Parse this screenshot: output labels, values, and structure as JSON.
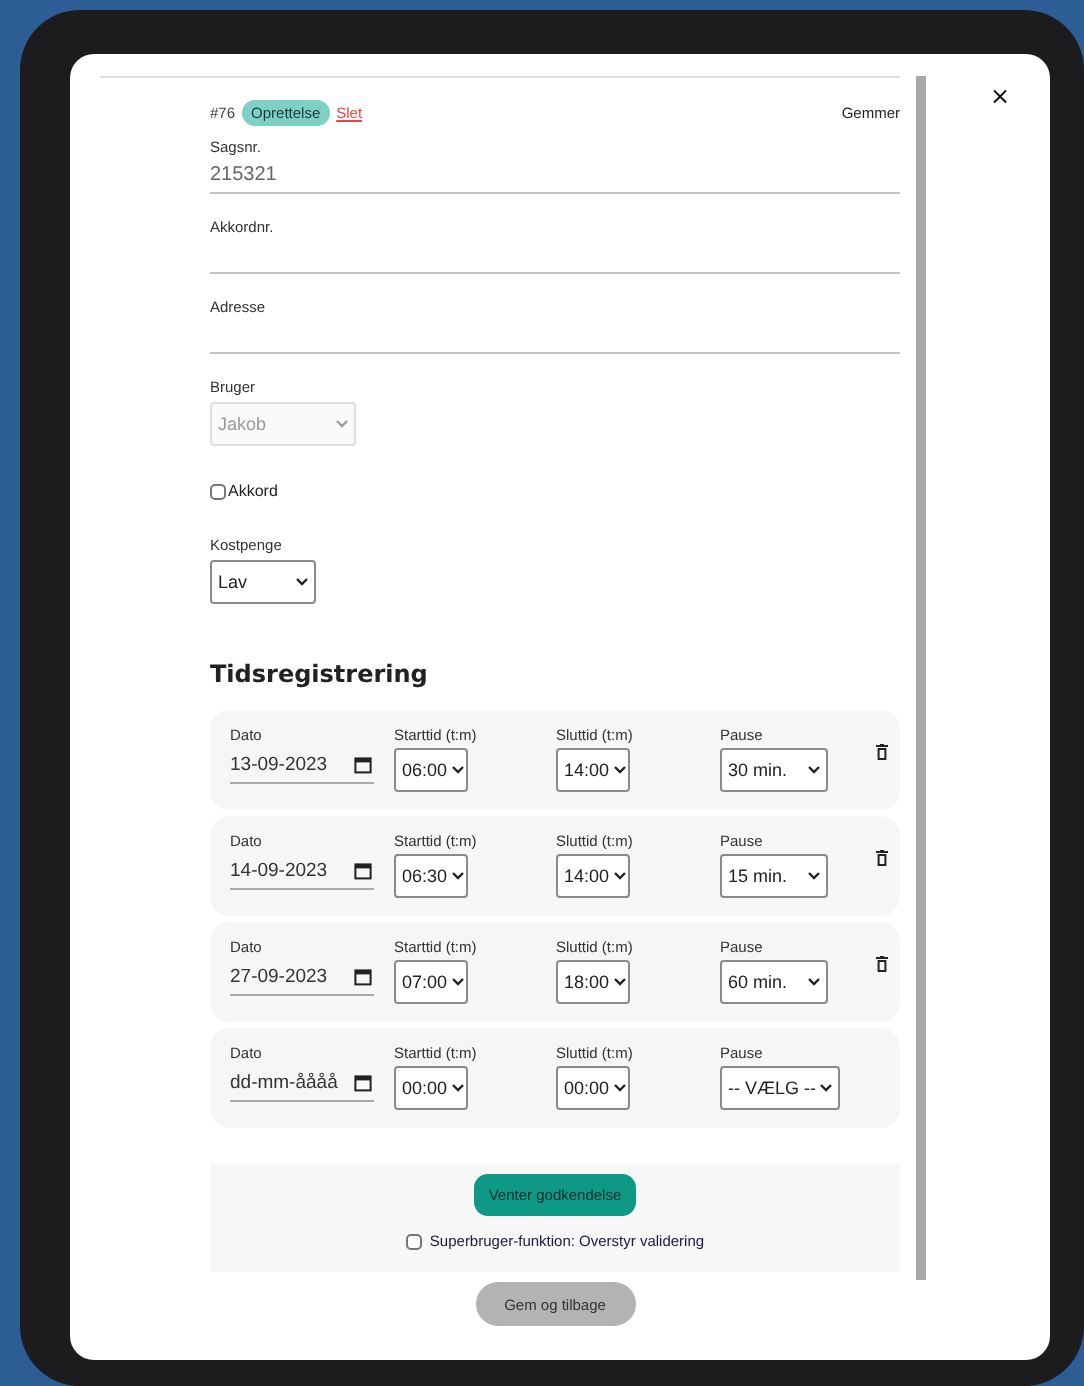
{
  "record": {
    "number": "#76",
    "status": "Oprettelse",
    "delete_link": "Slet",
    "save_status": "Gemmer"
  },
  "close": "×",
  "fields": [
    {
      "kind": "text",
      "label": "Sagsnr.",
      "value": "215321"
    },
    {
      "kind": "text",
      "label": "Akkordnr."
    },
    {
      "kind": "text",
      "label": "Adresse"
    },
    {
      "kind": "select",
      "label": "Bruger",
      "value": "Jakob",
      "disabled": true
    },
    {
      "kind": "checkbox",
      "label": "Akkord",
      "checked": false
    },
    {
      "kind": "select",
      "label": "Kostpenge",
      "value": "Lav",
      "disabled": false
    }
  ],
  "section_title": "Tidsregistrering",
  "time_rows": [
    {
      "date_label": "Dato",
      "date": "13-09-2023",
      "start_label": "Starttid (t:m)",
      "start": "06:00",
      "end_label": "Sluttid (t:m)",
      "end": "14:00",
      "pause_label": "Pause",
      "pause": "30 min.",
      "deletable": true
    },
    {
      "date_label": "Dato",
      "date": "14-09-2023",
      "start_label": "Starttid (t:m)",
      "start": "06:30",
      "end_label": "Sluttid (t:m)",
      "end": "14:00",
      "pause_label": "Pause",
      "pause": "15 min.",
      "deletable": true
    },
    {
      "date_label": "Dato",
      "date": "27-09-2023",
      "start_label": "Starttid (t:m)",
      "start": "07:00",
      "end_label": "Sluttid (t:m)",
      "end": "18:00",
      "pause_label": "Pause",
      "pause": "60 min.",
      "deletable": true
    },
    {
      "date_label": "Dato",
      "date_placeholder": "dd-mm-åååå",
      "start_label": "Starttid (t:m)",
      "start": "00:00",
      "end_label": "Sluttid (t:m)",
      "end": "00:00",
      "pause_label": "Pause",
      "pause": "-- VÆLG --",
      "deletable": false
    }
  ],
  "approval_button": "Venter godkendelse",
  "override": {
    "label": "Superbruger-funktion: Overstyr validering",
    "checked": false
  },
  "save_button": "Gem og tilbage"
}
